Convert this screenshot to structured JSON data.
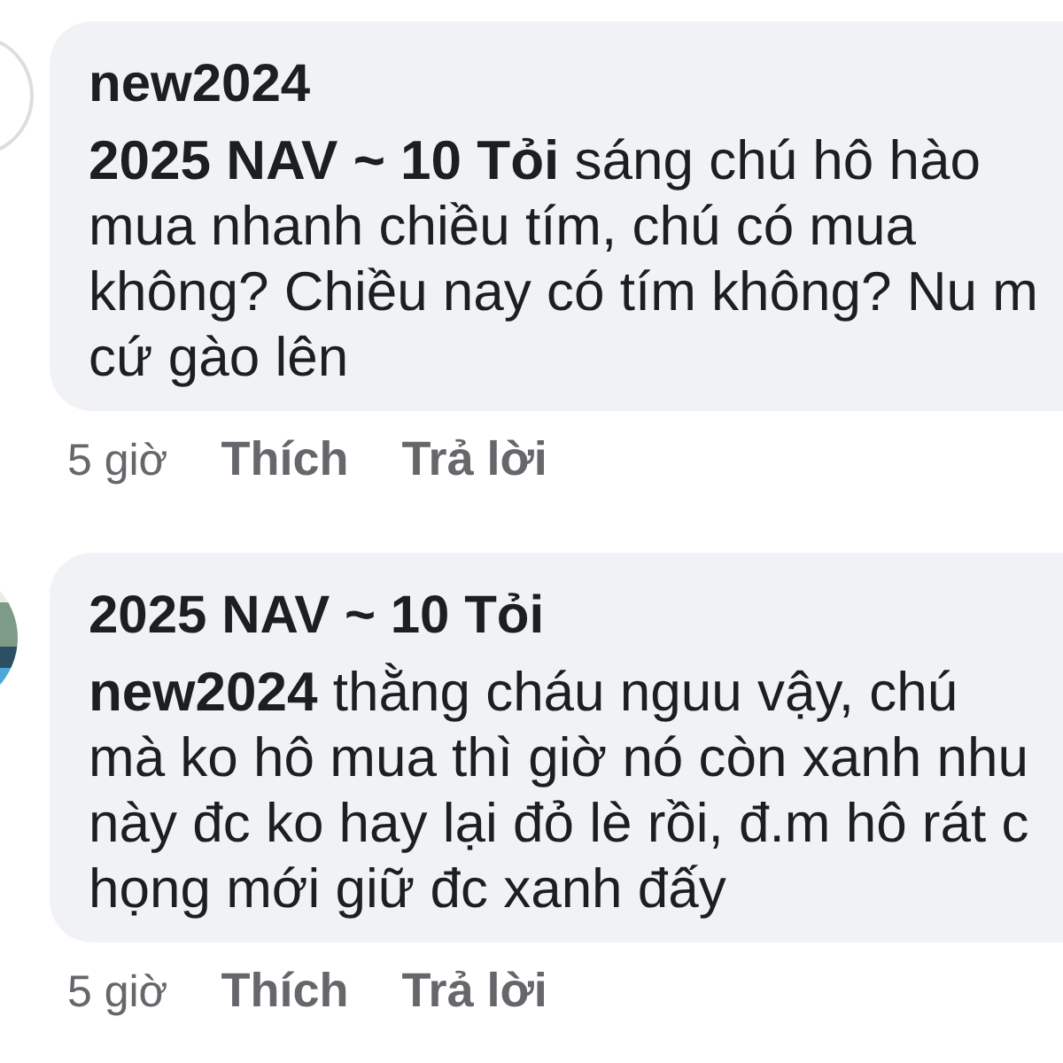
{
  "comments": [
    {
      "avatar": {
        "kind": "plain"
      },
      "author": "new2024",
      "lines": [
        "**2025 NAV ~ 10 Tỏi**  sáng chú hô hào",
        "mua nhanh chiều tím, chú có mua",
        "không? Chiều nay có tím không? Nu m",
        "cứ gào lên"
      ],
      "time": "5 giờ",
      "like": "Thích",
      "reply": "Trả lời"
    },
    {
      "author": "2025 NAV ~ 10 Tỏi",
      "lines": [
        "**new2024**  thằng cháu nguu vậy, chú",
        "mà ko hô mua thì giờ nó còn xanh nhu",
        "này đc ko hay lại đỏ lè rồi, đ.m hô rát c",
        "họng mới giữ đc xanh đấy"
      ],
      "time": "5 giờ",
      "like": "Thích",
      "reply": "Trả lời"
    }
  ]
}
